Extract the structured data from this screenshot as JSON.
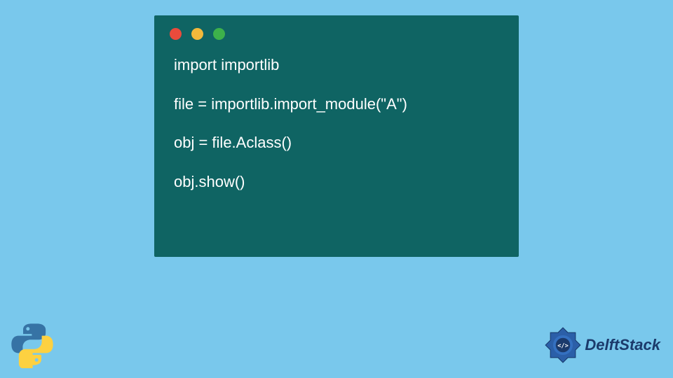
{
  "window_controls": {
    "red": "#e94b3c",
    "yellow": "#f2b93b",
    "green": "#3db14b"
  },
  "code": {
    "line1": "import importlib",
    "line2": "file = importlib.import_module(\"A\")",
    "line3": "obj = file.Aclass()",
    "line4": "obj.show()"
  },
  "branding": {
    "delft_label": "DelftStack"
  }
}
